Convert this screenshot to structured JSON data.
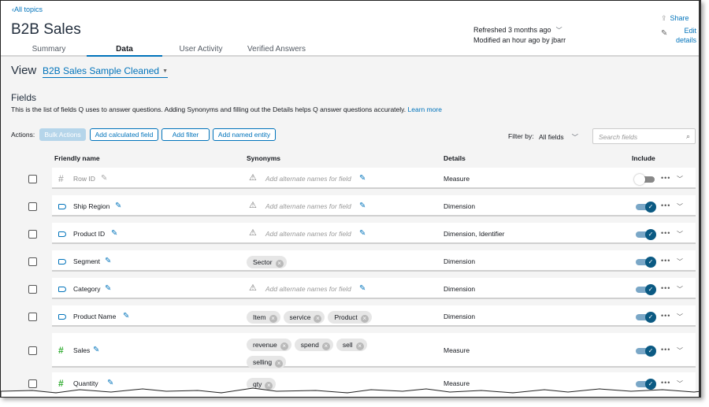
{
  "header": {
    "back_link": "All topics",
    "title": "B2B Sales",
    "tabs": [
      {
        "label": "Summary",
        "active": false
      },
      {
        "label": "Data",
        "active": true
      },
      {
        "label": "User Activity",
        "active": false
      },
      {
        "label": "Verified Answers",
        "active": false
      }
    ],
    "refreshed": "Refreshed 3 months ago",
    "modified": "Modified an hour ago by jbarr",
    "share_label": "Share",
    "edit_label_1": "Edit",
    "edit_label_2": "details"
  },
  "view": {
    "label": "View",
    "selected": "B2B Sales Sample Cleaned"
  },
  "fields": {
    "title": "Fields",
    "description": "This is the list of fields Q uses to answer questions. Adding Synonyms and filling out the Details helps Q answer questions accurately.",
    "learn_more": "Learn more"
  },
  "actions": {
    "label": "Actions:",
    "bulk": "Bulk Actions",
    "add_calculated": "Add calculated field",
    "add_filter": "Add filter",
    "add_named_entity": "Add named entity"
  },
  "filter": {
    "label": "Filter by:",
    "value": "All fields",
    "search_placeholder": "Search fields"
  },
  "columns": {
    "friendly_name": "Friendly name",
    "synonyms": "Synonyms",
    "details": "Details",
    "include": "Include"
  },
  "synonym_placeholder": "Add alternate names for field",
  "rows": [
    {
      "name": "Row ID",
      "type": "measure-disabled",
      "synonyms": [],
      "details": "Measure",
      "include": false
    },
    {
      "name": "Ship Region",
      "type": "dimension",
      "synonyms": [],
      "details": "Dimension",
      "include": true
    },
    {
      "name": "Product ID",
      "type": "dimension",
      "synonyms": [],
      "details": "Dimension, Identifier",
      "include": true
    },
    {
      "name": "Segment",
      "type": "dimension",
      "synonyms": [
        "Sector"
      ],
      "details": "Dimension",
      "include": true
    },
    {
      "name": "Category",
      "type": "dimension",
      "synonyms": [],
      "details": "Dimension",
      "include": true
    },
    {
      "name": "Product Name",
      "type": "dimension",
      "synonyms": [
        "Item",
        "service",
        "Product"
      ],
      "details": "Dimension",
      "include": true
    },
    {
      "name": "Sales",
      "type": "measure",
      "synonyms": [
        "revenue",
        "spend",
        "sell",
        "selling"
      ],
      "details": "Measure",
      "include": true
    },
    {
      "name": "Quantity",
      "type": "measure",
      "synonyms": [
        "qty"
      ],
      "details": "Measure",
      "include": true
    }
  ]
}
